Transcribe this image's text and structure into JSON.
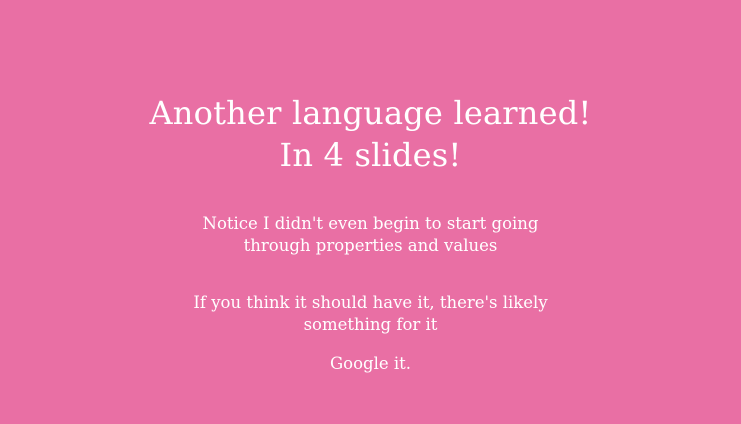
{
  "slide": {
    "background": "#e96fa4",
    "text_color": "#ffffff",
    "title_lines": [
      "Another language learned!",
      "In 4 slides!"
    ],
    "paragraphs": [
      {
        "lines": [
          "Notice I didn't even begin to start going",
          "through properties and values"
        ]
      },
      {
        "lines": [
          "If you think it should have it, there's likely",
          "something for it"
        ]
      },
      {
        "lines": [
          "Google it."
        ]
      }
    ]
  }
}
